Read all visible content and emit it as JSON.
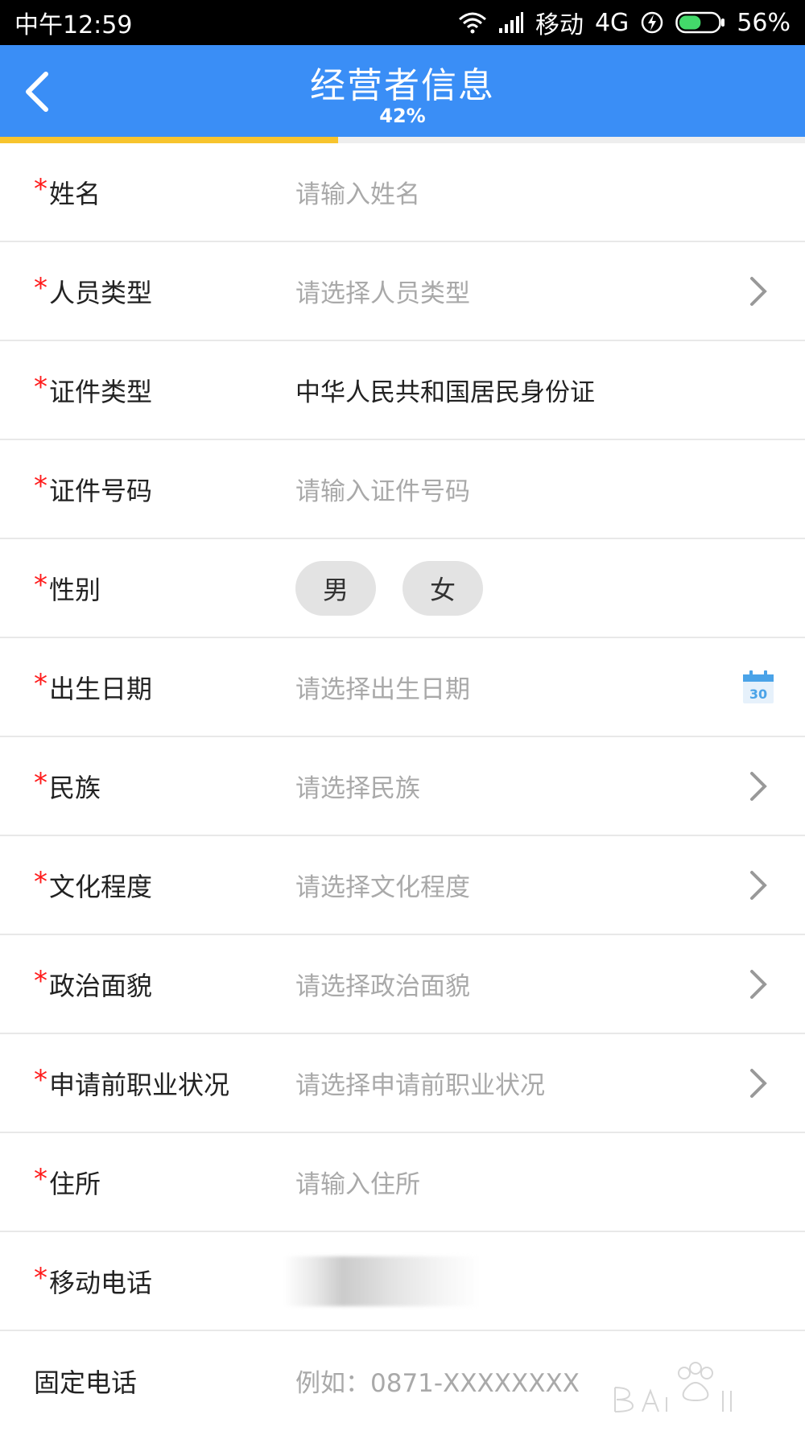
{
  "status_bar": {
    "time": "中午12:59",
    "carrier": "移动",
    "network": "4G",
    "battery_percent": "56%",
    "battery_level": 0.56
  },
  "header": {
    "title": "经营者信息",
    "progress_text": "42%",
    "progress_value": 0.42
  },
  "colors": {
    "header_bg": "#3a8ef6",
    "progress_fill": "#f7c42e",
    "required_star": "#ff1b1b",
    "placeholder": "#a9a9a9"
  },
  "form": {
    "name": {
      "label": "姓名",
      "placeholder": "请输入姓名",
      "required": "*"
    },
    "person_type": {
      "label": "人员类型",
      "placeholder": "请选择人员类型",
      "required": "*"
    },
    "id_type": {
      "label": "证件类型",
      "value": "中华人民共和国居民身份证",
      "required": "*"
    },
    "id_number": {
      "label": "证件号码",
      "placeholder": "请输入证件号码",
      "required": "*"
    },
    "gender": {
      "label": "性别",
      "options": [
        "男",
        "女"
      ],
      "required": "*"
    },
    "birth_date": {
      "label": "出生日期",
      "placeholder": "请选择出生日期",
      "required": "*",
      "calendar_day": "30"
    },
    "ethnicity": {
      "label": "民族",
      "placeholder": "请选择民族",
      "required": "*"
    },
    "education": {
      "label": "文化程度",
      "placeholder": "请选择文化程度",
      "required": "*"
    },
    "political_status": {
      "label": "政治面貌",
      "placeholder": "请选择政治面貌",
      "required": "*"
    },
    "prior_occupation": {
      "label": "申请前职业状况",
      "placeholder": "请选择申请前职业状况",
      "required": "*"
    },
    "address": {
      "label": "住所",
      "placeholder": "请输入住所",
      "required": "*"
    },
    "mobile": {
      "label": "移动电话",
      "required": "*"
    },
    "landline": {
      "label": "固定电话",
      "placeholder": "例如：0871-XXXXXXXX"
    }
  }
}
